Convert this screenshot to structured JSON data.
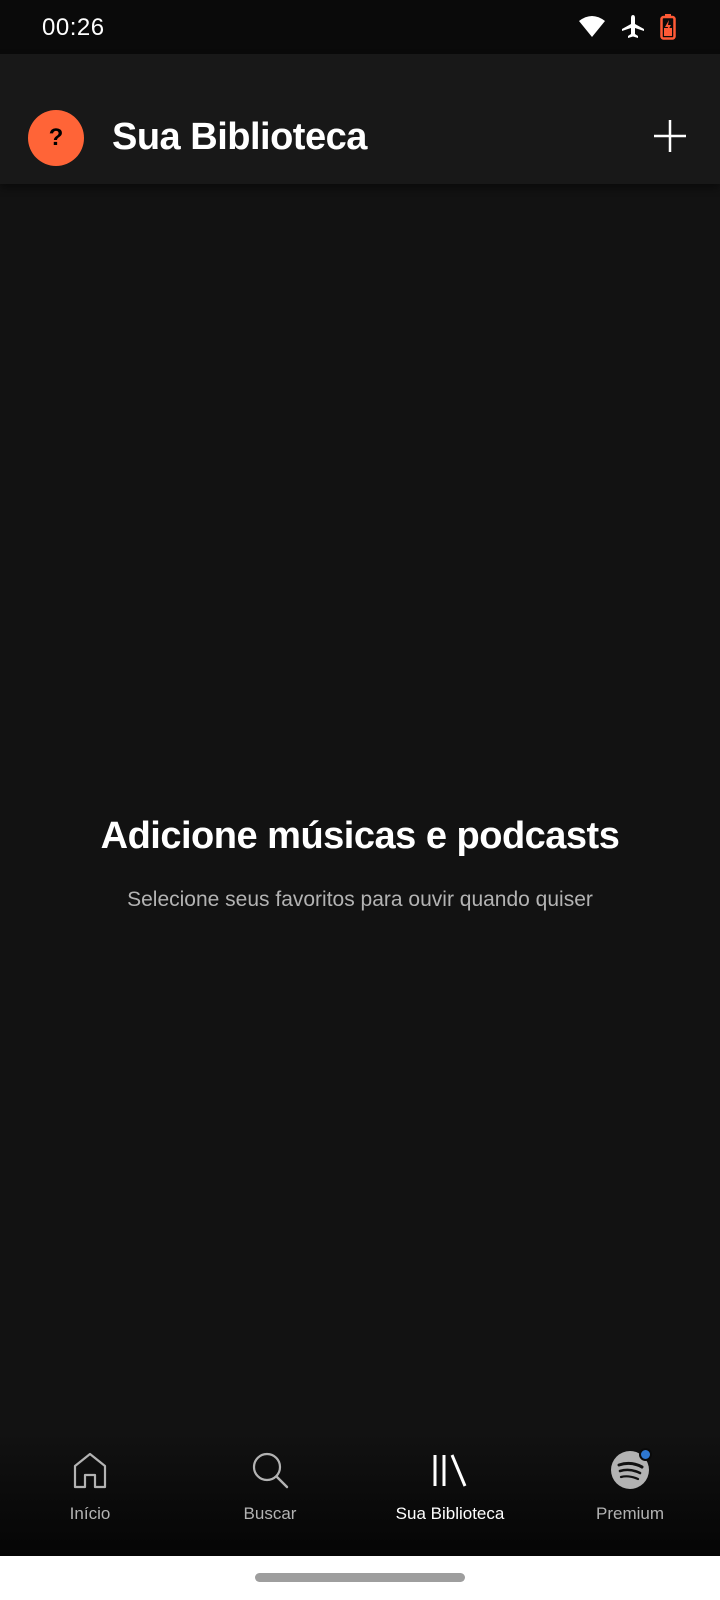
{
  "status_bar": {
    "time": "00:26",
    "icons": [
      "wifi-icon",
      "airplane-icon",
      "battery-icon"
    ],
    "battery_color": "#ff5a36"
  },
  "header": {
    "avatar_letter": "?",
    "avatar_color": "#ff6437",
    "title": "Sua Biblioteca",
    "add_icon": "plus-icon"
  },
  "empty_state": {
    "title": "Adicione músicas e podcasts",
    "subtitle": "Selecione seus favoritos para ouvir quando quiser"
  },
  "bottom_nav": {
    "items": [
      {
        "label": "Início",
        "icon": "home-icon",
        "active": false
      },
      {
        "label": "Buscar",
        "icon": "search-icon",
        "active": false
      },
      {
        "label": "Sua Biblioteca",
        "icon": "library-icon",
        "active": true
      },
      {
        "label": "Premium",
        "icon": "spotify-icon",
        "active": false,
        "badge": true
      }
    ],
    "badge_color": "#2e77d0"
  },
  "colors": {
    "background": "#121212",
    "header_background": "#181818",
    "text_primary": "#ffffff",
    "text_secondary": "#b3b3b3"
  }
}
